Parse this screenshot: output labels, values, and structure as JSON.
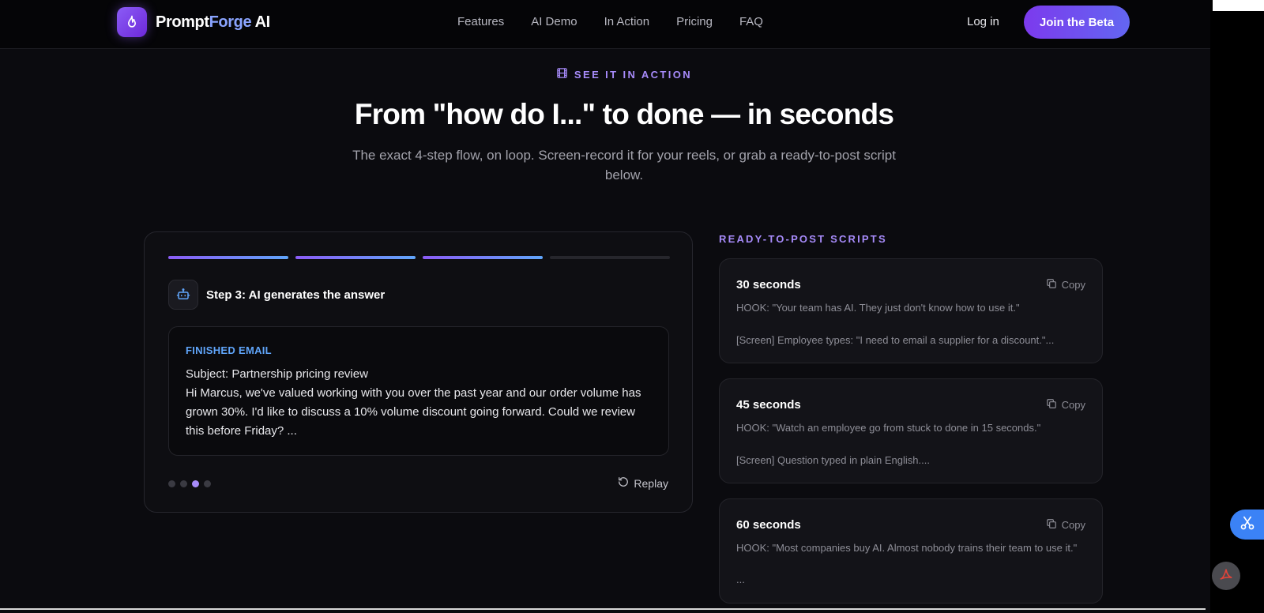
{
  "nav": {
    "brand_prompt": "Prompt",
    "brand_forge": "Forge",
    "brand_ai": " AI",
    "links": [
      "Features",
      "AI Demo",
      "In Action",
      "Pricing",
      "FAQ"
    ],
    "login": "Log in",
    "cta": "Join the Beta"
  },
  "hero": {
    "eyebrow": "SEE IT IN ACTION",
    "title": "From \"how do I...\" to done — in seconds",
    "subtitle": "The exact 4-step flow, on loop. Screen-record it for your reels, or grab a ready-to-post script below."
  },
  "demo": {
    "progress_completed": 3,
    "progress_total": 4,
    "step_title": "Step 3: AI generates the answer",
    "email_label": "FINISHED EMAIL",
    "email_subject": "Subject: Partnership pricing review",
    "email_body": "Hi Marcus, we've valued working with you over the past year and our order volume has grown 30%. I'd like to discuss a 10% volume discount going forward. Could we review this before Friday? ...",
    "active_dot": 3,
    "replay": "Replay"
  },
  "scripts": {
    "heading": "READY-TO-POST SCRIPTS",
    "copy_label": "Copy",
    "items": [
      {
        "duration": "30 seconds",
        "hook": "HOOK: \"Your team has AI. They just don't know how to use it.\"",
        "screen": "[Screen] Employee types: \"I need to email a supplier for a discount.\"..."
      },
      {
        "duration": "45 seconds",
        "hook": "HOOK: \"Watch an employee go from stuck to done in 15 seconds.\"",
        "screen": "[Screen] Question typed in plain English...."
      },
      {
        "duration": "60 seconds",
        "hook": "HOOK: \"Most companies buy AI. Almost nobody trains their team to use it.\"",
        "screen": "..."
      }
    ]
  },
  "colors": {
    "accent_purple": "#8b5cf6",
    "accent_blue": "#60a5fa",
    "background": "#0b0b0f"
  }
}
